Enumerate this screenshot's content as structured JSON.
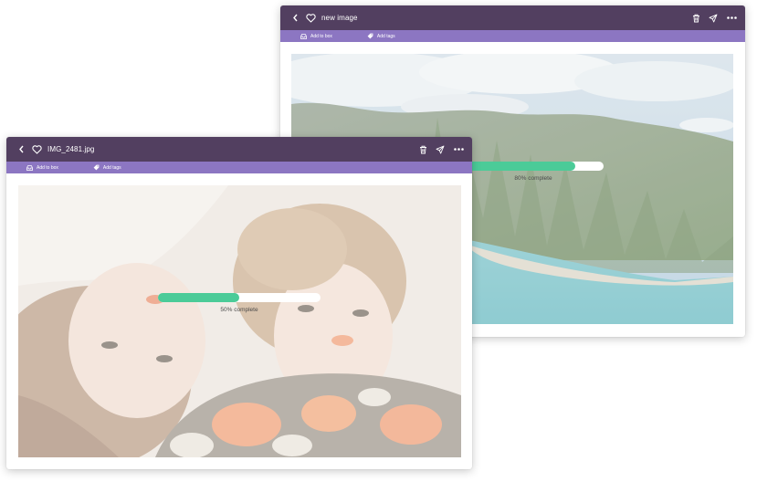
{
  "windows": {
    "back": {
      "title": "new image",
      "toolbar": {
        "add_to_box": "Add to box",
        "add_tags": "Add tags"
      },
      "upload": {
        "progress": 0.8,
        "label": "80% complete"
      }
    },
    "front": {
      "title": "IMG_2481.jpg",
      "toolbar": {
        "add_to_box": "Add to box",
        "add_tags": "Add tags"
      },
      "upload": {
        "progress": 0.5,
        "label": "50% complete"
      }
    }
  },
  "icons": [
    "chevron-left-icon",
    "heart-icon",
    "trash-icon",
    "send-icon",
    "more-icon",
    "inbox-icon",
    "tag-icon"
  ],
  "colors": {
    "titlebar": "#523f60",
    "toolbar": "#8c76c2",
    "progress_fill": "#4bcb98",
    "progress_track": "#ffffff"
  }
}
